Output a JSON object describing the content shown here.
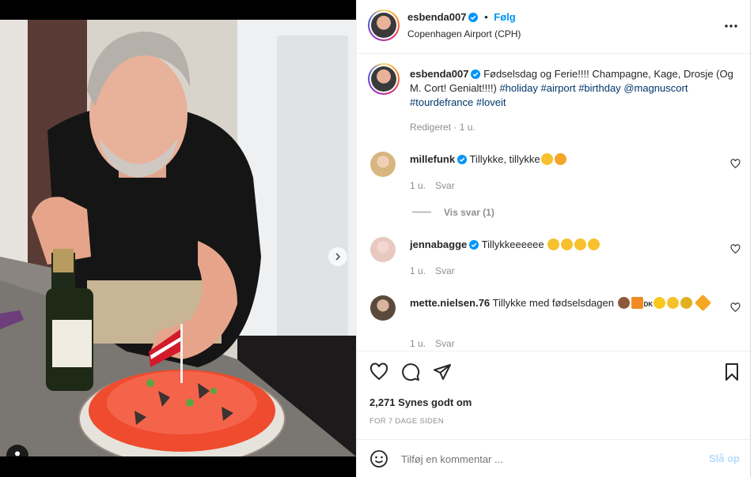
{
  "post": {
    "author": "esbenda007",
    "follow_label": "Følg",
    "separator": "•",
    "location": "Copenhagen Airport (CPH)",
    "more_label": "..."
  },
  "caption": {
    "username": "esbenda007",
    "text": "Fødselsdag og Ferie!!!! Champagne, Kage, Drosje (Og M. Cort! Genialt!!!!)",
    "tags": [
      "#holiday",
      "#airport",
      "#birthday",
      "@magnuscort",
      "#tourdefrance",
      "#loveit"
    ],
    "edited": "Redigeret",
    "time": "1 u."
  },
  "comments": [
    {
      "username": "millefunk",
      "verified": true,
      "text": "Tillykke, tillykke",
      "emojis": [
        "partying-face",
        "smiling-hearts-face"
      ],
      "time": "1 u.",
      "reply_label": "Svar",
      "view_replies": "Vis svar (1)"
    },
    {
      "username": "jennabagge",
      "verified": true,
      "text": "Tillykkeeeeee",
      "emojis": [
        "partying-face",
        "partying-face",
        "partying-face",
        "partying-face"
      ],
      "time": "1 u.",
      "reply_label": "Svar"
    },
    {
      "username": "mette.nielsen.76",
      "verified": false,
      "text": "Tillykke med fødselsdagen",
      "emojis": [
        "cake",
        "gift",
        "flag-dk",
        "sun",
        "smiley",
        "sunflower",
        "party-popper"
      ],
      "flag_text": "DK",
      "time": "1 u.",
      "reply_label": "Svar"
    }
  ],
  "actions": {
    "likes": "2,271 Synes godt om",
    "posted": "FOR 7 DAGE SIDEN"
  },
  "add_comment": {
    "placeholder": "Tilføj en kommentar ...",
    "post_label": "Slå op"
  },
  "colors": {
    "accent": "#0095f6",
    "hashtag": "#00376b",
    "muted": "#8e8e8e",
    "post_disabled": "#b3dbff"
  },
  "icons": [
    "chevron-right-icon",
    "user-tag-icon",
    "verified-badge-icon",
    "more-icon",
    "heart-icon",
    "comment-icon",
    "share-icon",
    "bookmark-icon",
    "emoji-icon"
  ]
}
